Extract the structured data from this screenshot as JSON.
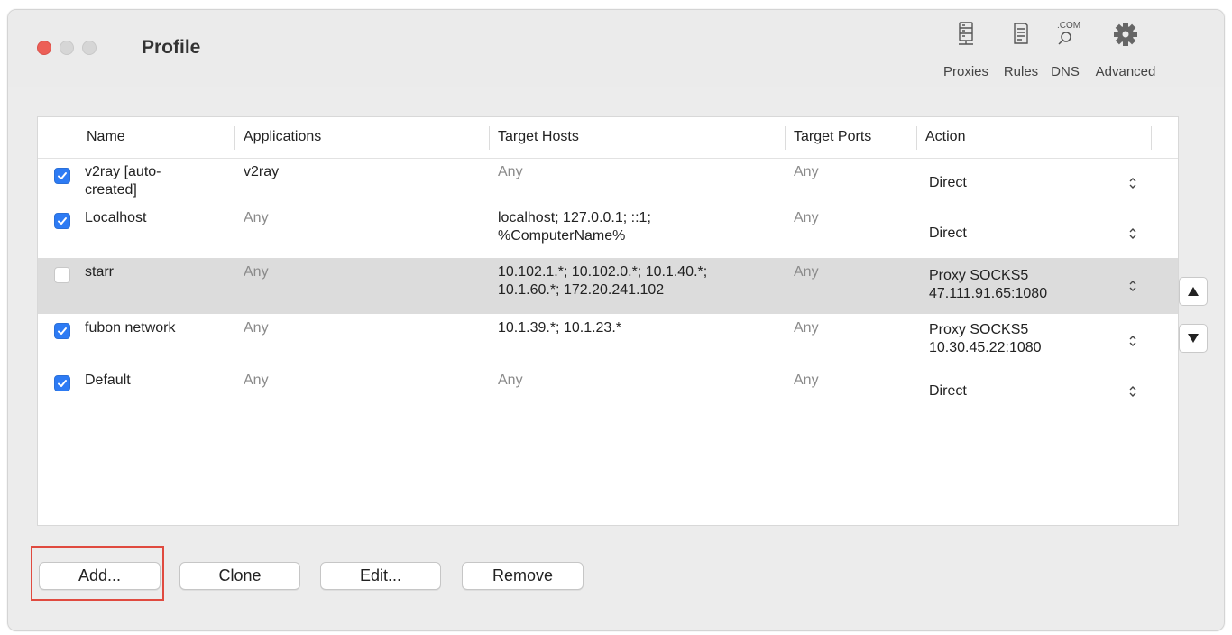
{
  "window": {
    "title": "Profile"
  },
  "toolbar": {
    "proxies": {
      "label": "Proxies",
      "icon": "proxies-server-icon"
    },
    "rules": {
      "label": "Rules",
      "icon": "rules-document-icon"
    },
    "dns": {
      "label": "DNS",
      "icon": "dns-com-icon",
      "glyph": ".COM"
    },
    "advanced": {
      "label": "Advanced",
      "icon": "gear-icon"
    }
  },
  "table": {
    "columns": [
      "Name",
      "Applications",
      "Target Hosts",
      "Target Ports",
      "Action"
    ],
    "rows": [
      {
        "checked": true,
        "name": "v2ray [auto-\ncreated]",
        "applications": "v2ray",
        "hosts": "Any",
        "ports": "Any",
        "action": "Direct"
      },
      {
        "checked": true,
        "name": "Localhost",
        "applications": "Any",
        "hosts": "localhost; 127.0.0.1; ::1;\n%ComputerName%",
        "ports": "Any",
        "action": "Direct"
      },
      {
        "checked": false,
        "name": "starr",
        "applications": "Any",
        "hosts": "10.102.1.*; 10.102.0.*; 10.1.40.*;\n10.1.60.*; 172.20.241.102",
        "ports": "Any",
        "action": "Proxy SOCKS5\n47.111.91.65:1080"
      },
      {
        "checked": true,
        "name": "fubon network",
        "applications": "Any",
        "hosts": "10.1.39.*; 10.1.23.*",
        "ports": "Any",
        "action": "Proxy SOCKS5\n10.30.45.22:1080"
      },
      {
        "checked": true,
        "name": "Default",
        "applications": "Any",
        "hosts": "Any",
        "ports": "Any",
        "action": "Direct"
      }
    ]
  },
  "buttons": {
    "add": "Add...",
    "clone": "Clone",
    "edit": "Edit...",
    "remove": "Remove"
  },
  "colors": {
    "accent": "#2d7bf4",
    "selected_row": "#dcdcdc",
    "highlight": "#e04a3f",
    "close_light": "#ec5f57"
  }
}
